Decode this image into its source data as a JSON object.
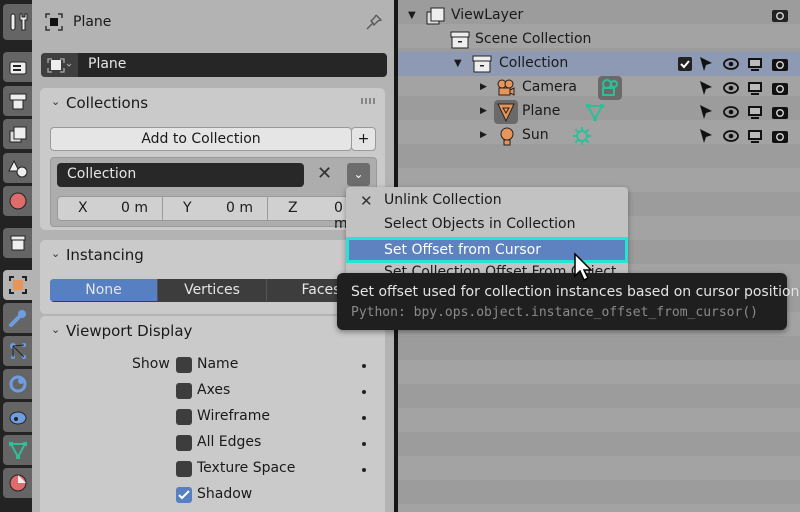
{
  "properties": {
    "header_title": "Plane",
    "object_name": "Plane",
    "tabs": [
      {
        "name": "tool",
        "active": false
      },
      {
        "name": "render",
        "active": false
      },
      {
        "name": "output",
        "active": false
      },
      {
        "name": "view-layer",
        "active": false
      },
      {
        "name": "scene",
        "active": false
      },
      {
        "name": "world",
        "active": false
      },
      {
        "name": "collection",
        "active": false
      },
      {
        "name": "object",
        "active": true
      },
      {
        "name": "modifiers",
        "active": false
      },
      {
        "name": "particles",
        "active": false
      },
      {
        "name": "physics",
        "active": false
      },
      {
        "name": "constraints",
        "active": false
      },
      {
        "name": "data",
        "active": false
      },
      {
        "name": "material",
        "active": false
      }
    ],
    "collections_panel": {
      "title": "Collections",
      "add_button": "Add to Collection",
      "add_plus": "+",
      "collection_name": "Collection",
      "offset": [
        {
          "axis": "X",
          "value": "0 m"
        },
        {
          "axis": "Y",
          "value": "0 m"
        },
        {
          "axis": "Z",
          "value": "0 m"
        }
      ]
    },
    "instancing_panel": {
      "title": "Instancing",
      "options": [
        "None",
        "Vertices",
        "Faces"
      ],
      "selected": "None"
    },
    "viewport_display_panel": {
      "title": "Viewport Display",
      "show_label": "Show",
      "checkboxes": [
        {
          "label": "Name",
          "checked": false
        },
        {
          "label": "Axes",
          "checked": false
        },
        {
          "label": "Wireframe",
          "checked": false
        },
        {
          "label": "All Edges",
          "checked": false
        },
        {
          "label": "Texture Space",
          "checked": false
        },
        {
          "label": "Shadow",
          "checked": true
        }
      ]
    }
  },
  "outliner": {
    "rows": [
      {
        "label": "ViewLayer",
        "type": "view-layer"
      },
      {
        "label": "Scene Collection",
        "type": "scene-collection"
      },
      {
        "label": "Collection",
        "type": "collection",
        "selected": true
      },
      {
        "label": "Camera",
        "type": "camera"
      },
      {
        "label": "Plane",
        "type": "mesh"
      },
      {
        "label": "Sun",
        "type": "light"
      }
    ]
  },
  "context_menu": {
    "items": [
      {
        "label": "Unlink Collection",
        "icon": "x-icon"
      },
      {
        "label": "Select Objects in Collection"
      },
      {
        "label": "Set Offset from Cursor",
        "highlighted": true
      },
      {
        "label": "Set Collection Offset From Object"
      }
    ]
  },
  "tooltip": {
    "description": "Set offset used for collection instances based on cursor position.",
    "python": "Python: bpy.ops.object.instance_offset_from_cursor()"
  },
  "colors": {
    "accent_blue": "#5680c2",
    "highlight_outline": "#28e2d2",
    "object_orange": "#e8955a",
    "data_green": "#2fbf97"
  }
}
